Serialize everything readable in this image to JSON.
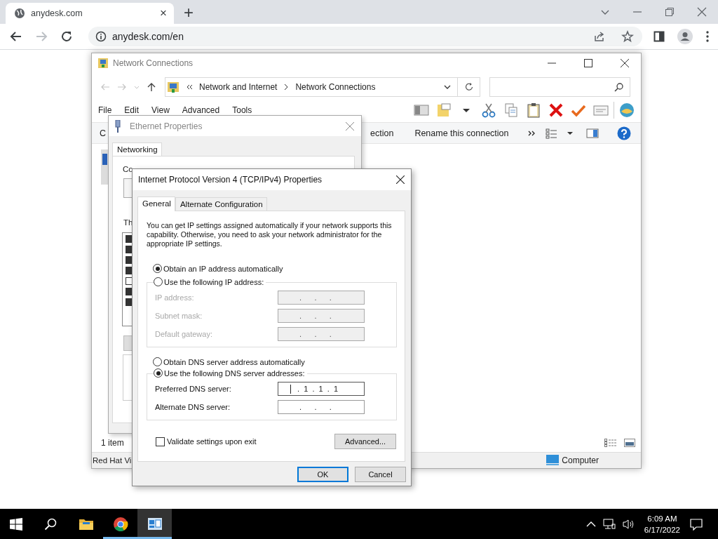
{
  "browser": {
    "tab": {
      "title": "anydesk.com",
      "close": "×"
    },
    "new_tab": "+",
    "address": "anydesk.com/en"
  },
  "explorer": {
    "title": "Network Connections",
    "breadcrumb": [
      "Network and Internet",
      "Network Connections"
    ],
    "menu": [
      "File",
      "Edit",
      "View",
      "Advanced",
      "Tools"
    ],
    "commands": [
      "C",
      "ection",
      "Rename this connection"
    ],
    "item_count": "1 item",
    "status_left": "Red Hat Vi",
    "status_right": "Computer"
  },
  "ethernet": {
    "title": "Ethernet Properties",
    "tabs": [
      {
        "label": "Networking",
        "selected": true
      }
    ],
    "connect_label": "Co",
    "components_label": "Th",
    "components": [
      {
        "checked": true
      },
      {
        "checked": true
      },
      {
        "checked": true
      },
      {
        "checked": true
      },
      {
        "checked": false
      },
      {
        "checked": true
      },
      {
        "checked": true
      }
    ]
  },
  "dialog": {
    "title": "Internet Protocol Version 4 (TCP/IPv4) Properties",
    "tabs": [
      {
        "label": "General",
        "selected": true
      },
      {
        "label": "Alternate Configuration",
        "selected": false
      }
    ],
    "intro": "You can get IP settings assigned automatically if your network supports this capability. Otherwise, you need to ask your network administrator for the appropriate IP settings.",
    "ip_mode": [
      {
        "label": "Obtain an IP address automatically",
        "selected": true
      },
      {
        "label": "Use the following IP address:",
        "selected": false
      }
    ],
    "ip_fields": [
      {
        "label": "IP address:",
        "value": ".      .      .",
        "disabled": true
      },
      {
        "label": "Subnet mask:",
        "value": ".      .      .",
        "disabled": true
      },
      {
        "label": "Default gateway:",
        "value": ".      .      .",
        "disabled": true
      }
    ],
    "dns_mode": [
      {
        "label": "Obtain DNS server address automatically",
        "selected": false
      },
      {
        "label": "Use the following DNS server addresses:",
        "selected": true
      }
    ],
    "dns_fields": [
      {
        "label": "Preferred DNS server:",
        "value": ".  1  .  1  .  1",
        "disabled": false,
        "focused": true
      },
      {
        "label": "Alternate DNS server:",
        "value": ".      .      .",
        "disabled": false,
        "focused": false
      }
    ],
    "validate": {
      "label": "Validate settings upon exit",
      "checked": false
    },
    "advanced": "Advanced...",
    "ok": "OK",
    "cancel": "Cancel"
  },
  "taskbar": {
    "apps": [
      {
        "kind": "explorer",
        "running": false,
        "active": false
      },
      {
        "kind": "chrome",
        "running": true,
        "active": false
      },
      {
        "kind": "network",
        "running": true,
        "active": true
      }
    ],
    "time": "6:09 AM",
    "date": "6/17/2022"
  }
}
